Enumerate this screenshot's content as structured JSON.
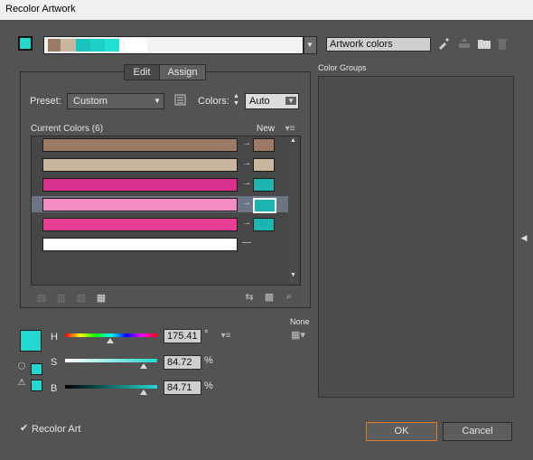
{
  "window": {
    "title": "Recolor Artwork"
  },
  "header": {
    "artwork_field": "Artwork colors",
    "strip_colors": [
      "#9c7a66",
      "#c9b69e",
      "#19c3be",
      "#1ad0c8",
      "#22e0d4",
      "#ffffff"
    ],
    "active_swatch": "#23d8cf"
  },
  "tabs": {
    "edit": "Edit",
    "assign": "Assign"
  },
  "preset": {
    "label": "Preset:",
    "value": "Custom"
  },
  "colors_ctrl": {
    "label": "Colors:",
    "value": "Auto"
  },
  "table": {
    "header_current": "Current Colors (6)",
    "header_new": "New",
    "rows": [
      {
        "current": "#9c7a66",
        "new": "#9c7a66"
      },
      {
        "current": "#c9b69e",
        "new": "#c9b69e"
      },
      {
        "current": "#d6318c",
        "new": "#1ab5b0"
      },
      {
        "current": "#f48bc2",
        "new": "#1ab5b0"
      },
      {
        "current": "#e83f95",
        "new": "#1ab5b0"
      },
      {
        "current": "#ffffff",
        "new": "—"
      }
    ]
  },
  "hsb": {
    "h_label": "H",
    "h_value": "175.41",
    "h_unit": "°",
    "s_label": "S",
    "s_value": "84.72",
    "s_unit": "%",
    "b_label": "B",
    "b_value": "84.71",
    "b_unit": "%",
    "h_fraction": 0.49,
    "s_fraction": 0.85,
    "b_fraction": 0.85
  },
  "none_label": "None",
  "color_groups": {
    "title": "Color Groups"
  },
  "recolor_art": {
    "label": "Recolor Art",
    "checked": true
  },
  "buttons": {
    "ok": "OK",
    "cancel": "Cancel"
  },
  "icons": {
    "eyedropper": "eyedropper-icon",
    "save_group": "save-group-icon",
    "folder": "folder-icon",
    "trash": "trash-icon"
  }
}
